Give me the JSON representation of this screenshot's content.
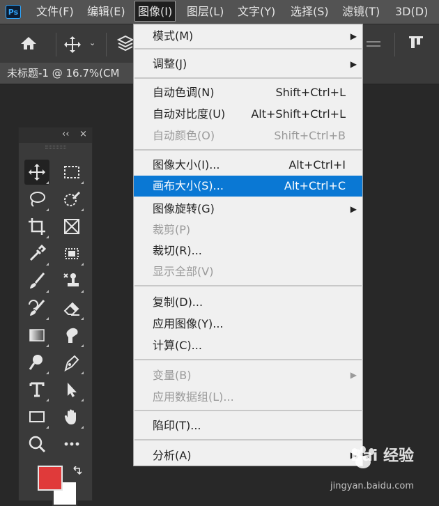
{
  "menubar": {
    "logo": "Ps",
    "items": [
      {
        "label": "文件(F)"
      },
      {
        "label": "编辑(E)"
      },
      {
        "label": "图像(I)"
      },
      {
        "label": "图层(L)"
      },
      {
        "label": "文字(Y)"
      },
      {
        "label": "选择(S)"
      },
      {
        "label": "滤镜(T)"
      },
      {
        "label": "3D(D)"
      }
    ]
  },
  "document": {
    "tab_title": "未标题-1 @ 16.7%(CM"
  },
  "image_menu": {
    "items": [
      {
        "label": "模式(M)",
        "submenu": true
      },
      {
        "label": "调整(J)",
        "submenu": true
      },
      {
        "label": "自动色调(N)",
        "shortcut": "Shift+Ctrl+L"
      },
      {
        "label": "自动对比度(U)",
        "shortcut": "Alt+Shift+Ctrl+L"
      },
      {
        "label": "自动颜色(O)",
        "shortcut": "Shift+Ctrl+B",
        "disabled": true
      },
      {
        "label": "图像大小(I)...",
        "shortcut": "Alt+Ctrl+I"
      },
      {
        "label": "画布大小(S)...",
        "shortcut": "Alt+Ctrl+C",
        "highlighted": true
      },
      {
        "label": "图像旋转(G)",
        "submenu": true
      },
      {
        "label": "裁剪(P)",
        "disabled": true
      },
      {
        "label": "裁切(R)..."
      },
      {
        "label": "显示全部(V)",
        "disabled": true
      },
      {
        "label": "复制(D)..."
      },
      {
        "label": "应用图像(Y)..."
      },
      {
        "label": "计算(C)..."
      },
      {
        "label": "变量(B)",
        "submenu": true,
        "disabled": true
      },
      {
        "label": "应用数据组(L)...",
        "disabled": true
      },
      {
        "label": "陷印(T)..."
      },
      {
        "label": "分析(A)",
        "submenu": true
      }
    ]
  },
  "tools_panel": {
    "collapse": "‹‹",
    "close": "×",
    "tools": [
      "move-tool",
      "marquee-tool",
      "lasso-tool",
      "quick-select-tool",
      "crop-tool",
      "frame-tool",
      "eyedropper-tool",
      "patch-tool",
      "brush-tool",
      "stamp-tool",
      "history-brush-tool",
      "eraser-tool",
      "gradient-tool",
      "smudge-tool",
      "dodge-tool",
      "pen-tool",
      "type-tool",
      "path-select-tool",
      "rectangle-tool",
      "hand-tool",
      "zoom-tool",
      "more-tools"
    ]
  },
  "colors": {
    "foreground": "#e03a3a",
    "background": "#ffffff",
    "highlight": "#0a78d4"
  },
  "watermark": {
    "brand": "Bai",
    "brand2": "经验",
    "url": "jingyan.baidu.com"
  }
}
